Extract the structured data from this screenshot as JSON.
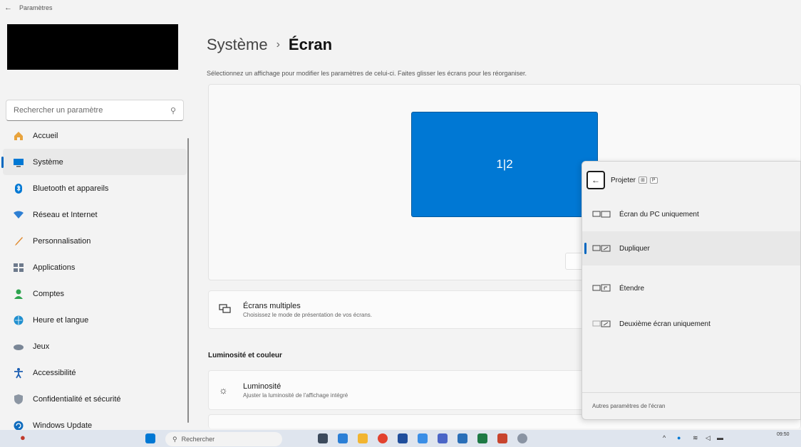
{
  "window": {
    "title": "Paramètres"
  },
  "sidebar": {
    "search_placeholder": "Rechercher un paramètre",
    "items": [
      {
        "label": "Accueil",
        "icon": "home-icon"
      },
      {
        "label": "Système",
        "icon": "system-icon",
        "active": true
      },
      {
        "label": "Bluetooth et appareils",
        "icon": "bluetooth-icon"
      },
      {
        "label": "Réseau et Internet",
        "icon": "network-icon"
      },
      {
        "label": "Personnalisation",
        "icon": "brush-icon"
      },
      {
        "label": "Applications",
        "icon": "apps-icon"
      },
      {
        "label": "Comptes",
        "icon": "accounts-icon"
      },
      {
        "label": "Heure et langue",
        "icon": "globe-icon"
      },
      {
        "label": "Jeux",
        "icon": "gamepad-icon"
      },
      {
        "label": "Accessibilité",
        "icon": "accessibility-icon"
      },
      {
        "label": "Confidentialité et sécurité",
        "icon": "shield-icon"
      },
      {
        "label": "Windows Update",
        "icon": "update-icon"
      }
    ]
  },
  "main": {
    "breadcrumb_parent": "Système",
    "breadcrumb_separator": "›",
    "breadcrumb_current": "Écran",
    "subtitle": "Sélectionnez un affichage pour modifier les paramètres de celui-ci. Faites glisser les écrans pour les réorganiser.",
    "monitor_label": "1|2",
    "multi_display": {
      "title": "Écrans multiples",
      "desc": "Choisissez le mode de présentation de vos écrans."
    },
    "section_brightness": "Luminosité et couleur",
    "brightness": {
      "title": "Luminosité",
      "desc": "Ajuster la luminosité de l'affichage intégré"
    }
  },
  "flyout": {
    "title": "Projeter",
    "shortcut_keys": [
      "⊞",
      "P"
    ],
    "options": [
      {
        "label": "Écran du PC uniquement",
        "selected": false
      },
      {
        "label": "Dupliquer",
        "selected": true
      },
      {
        "label": "Étendre",
        "selected": false
      },
      {
        "label": "Deuxième écran uniquement",
        "selected": false
      }
    ],
    "footer_link": "Autres paramètres de l'écran"
  },
  "taskbar": {
    "search_placeholder": "Rechercher",
    "clock_time": "09:50",
    "accent": "#0078d4"
  }
}
